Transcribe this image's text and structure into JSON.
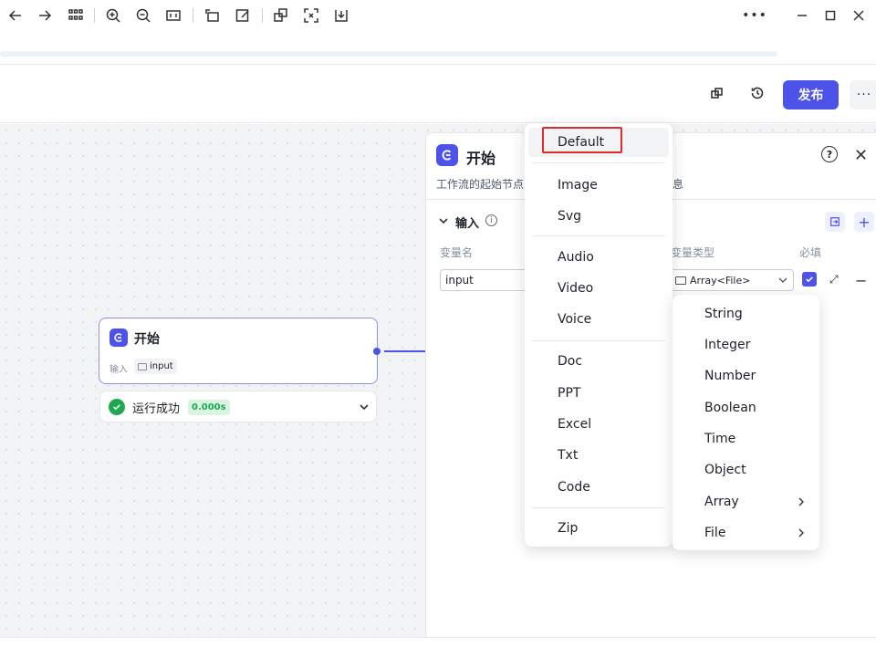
{
  "canvas_node": {
    "title": "开始",
    "input_label": "输入",
    "input_tag": "input",
    "run_status": "运行成功",
    "run_time": "0.000s"
  },
  "header": {
    "publish_label": "发布",
    "more_label": "···"
  },
  "panel": {
    "title": "开始",
    "description": "工作流的起始节点",
    "description_tail": "息",
    "section_title": "输入",
    "col_name": "变量名",
    "col_type": "变量类型",
    "col_required": "必填",
    "row": {
      "name": "input",
      "type": "Array<File>",
      "required": true
    }
  },
  "file_type_menu": {
    "selected": "Default",
    "groups": [
      [
        "Default"
      ],
      [
        "Image",
        "Svg"
      ],
      [
        "Audio",
        "Video",
        "Voice"
      ],
      [
        "Doc",
        "PPT",
        "Excel",
        "Txt",
        "Code"
      ],
      [
        "Zip"
      ]
    ]
  },
  "var_type_menu": {
    "items": [
      "String",
      "Integer",
      "Number",
      "Boolean",
      "Time",
      "Object",
      "Array",
      "File"
    ],
    "submenu_items": [
      "Array",
      "File"
    ]
  },
  "colors": {
    "accent": "#4d53e8",
    "success": "#1fa851",
    "highlight": "#e02b2b"
  }
}
